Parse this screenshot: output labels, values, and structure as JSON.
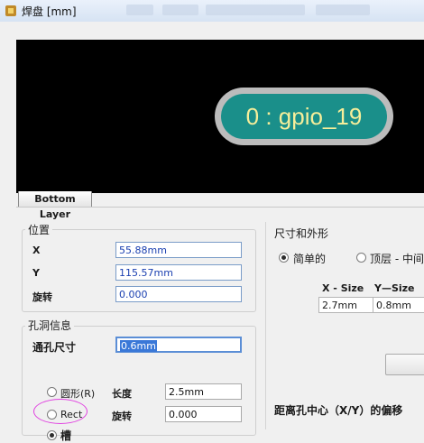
{
  "window": {
    "title": "焊盘 [mm]"
  },
  "preview": {
    "pad_text": "0 : gpio_19",
    "layer_tab": "Bottom Layer",
    "pad_color": "#1a8f8a",
    "text_color": "#f6ee9a"
  },
  "position": {
    "title": "位置",
    "x_label": "X",
    "x_value": "55.88mm",
    "y_label": "Y",
    "y_value": "115.57mm",
    "rotation_label": "旋转",
    "rotation_value": "0.000"
  },
  "hole": {
    "title": "孔洞信息",
    "size_label": "通孔尺寸",
    "size_value": "0.6mm",
    "round_label": "圆形(R)",
    "rect_label": "Rect",
    "slot_label": "槽",
    "selected": "slot",
    "length_label": "长度",
    "length_value": "2.5mm",
    "rotation_label": "旋转",
    "rotation_value": "0.000"
  },
  "size_shape": {
    "title": "尺寸和外形",
    "simple_label": "简单的",
    "top_mid_label": "顶层 - 中间",
    "selected": "simple",
    "col_x": "X - Size",
    "col_y": "Y—Size",
    "x_size": "2.7mm",
    "y_size": "0.8mm"
  },
  "offset": {
    "label": "距离孔中心（X/Y）的偏移"
  }
}
